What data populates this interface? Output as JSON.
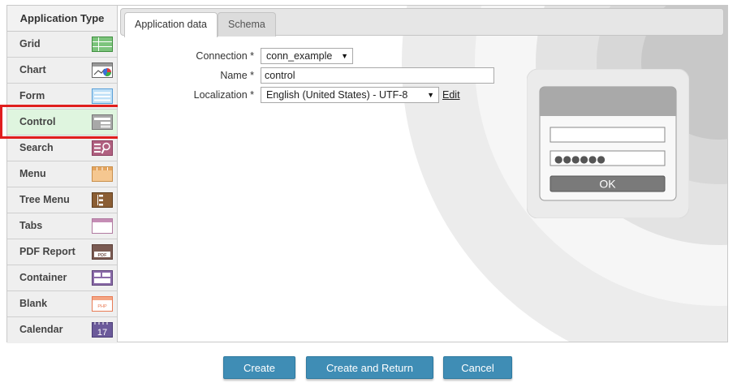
{
  "sidebar": {
    "header": "Application Type",
    "items": [
      {
        "label": "Grid",
        "icon": "grid-icon"
      },
      {
        "label": "Chart",
        "icon": "chart-icon"
      },
      {
        "label": "Form",
        "icon": "form-icon"
      },
      {
        "label": "Control",
        "icon": "control-icon",
        "selected": true
      },
      {
        "label": "Search",
        "icon": "search-icon"
      },
      {
        "label": "Menu",
        "icon": "menu-icon"
      },
      {
        "label": "Tree Menu",
        "icon": "tree-menu-icon"
      },
      {
        "label": "Tabs",
        "icon": "tabs-icon"
      },
      {
        "label": "PDF Report",
        "icon": "pdf-report-icon"
      },
      {
        "label": "Container",
        "icon": "container-icon"
      },
      {
        "label": "Blank",
        "icon": "blank-icon"
      },
      {
        "label": "Calendar",
        "icon": "calendar-icon"
      }
    ]
  },
  "tabs": [
    {
      "label": "Application data",
      "active": true
    },
    {
      "label": "Schema",
      "active": false
    }
  ],
  "form": {
    "connection_label": "Connection *",
    "connection_value": "conn_example",
    "name_label": "Name *",
    "name_value": "control",
    "localization_label": "Localization *",
    "localization_value": "English (United States) - UTF-8",
    "edit_link": "Edit"
  },
  "illustration": {
    "password_mask": "●●●●●●",
    "ok_label": "OK",
    "pdf_icon_text": "PDF",
    "blank_icon_text": "PHP",
    "calendar_icon_day": "17"
  },
  "buttons": {
    "create": "Create",
    "create_and_return": "Create and Return",
    "cancel": "Cancel"
  }
}
